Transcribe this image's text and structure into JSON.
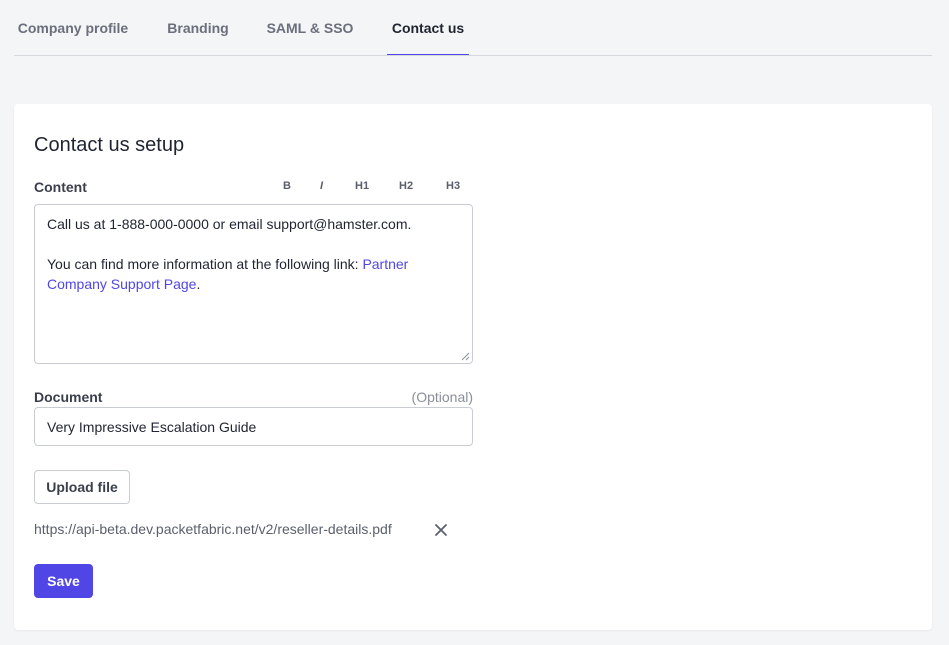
{
  "tabs": [
    {
      "label": "Company profile",
      "active": false
    },
    {
      "label": "Branding",
      "active": false
    },
    {
      "label": "SAML & SSO",
      "active": false
    },
    {
      "label": "Contact us",
      "active": true
    }
  ],
  "card": {
    "title": "Contact us setup",
    "content": {
      "label": "Content",
      "toolbar": {
        "bold": "B",
        "italic": "I",
        "h1": "H1",
        "h2": "H2",
        "h3": "H3"
      },
      "line1": "Call us at 1-888-000-0000 or email support@hamster.com.",
      "line2_prefix": "You can find more information at the following link: ",
      "link_text": "Partner Company Support Page",
      "line2_suffix": "."
    },
    "document": {
      "label": "Document",
      "optional": "(Optional)",
      "value": "Very Impressive Escalation Guide"
    },
    "upload_label": "Upload file",
    "file_url": "https://api-beta.dev.packetfabric.net/v2/reseller-details.pdf",
    "save_label": "Save"
  },
  "colors": {
    "accent": "#5046e5",
    "background": "#f4f5f7",
    "card": "#ffffff"
  },
  "icons": {
    "remove": "close-icon",
    "resize": "resize-grip-icon"
  }
}
